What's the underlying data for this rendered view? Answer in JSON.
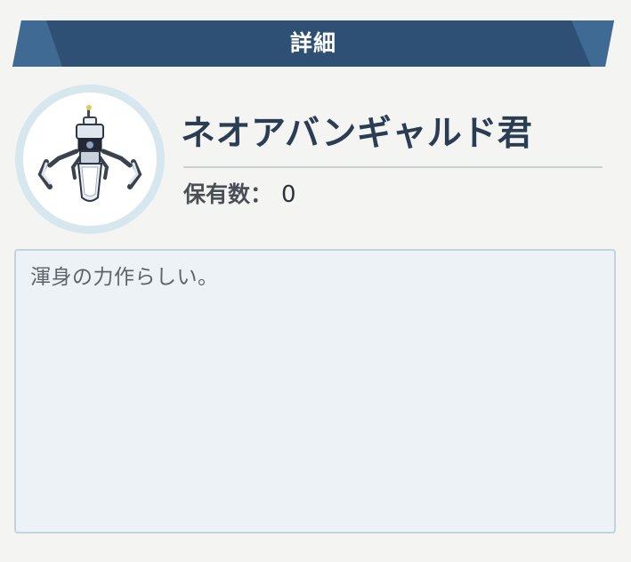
{
  "header": {
    "title": "詳細"
  },
  "item": {
    "name": "ネオアバンギャルド君",
    "owned_label": "保有数：",
    "owned_count": "0",
    "icon": "spider-robot-icon",
    "description": "渾身の力作らしい。"
  },
  "colors": {
    "header_bar": "#2e5075",
    "header_bar_accent": "#3f6a94",
    "name_text": "#2a3d53",
    "description_box": "#ecf2f6",
    "avatar_ring": "#d6e7ee"
  }
}
